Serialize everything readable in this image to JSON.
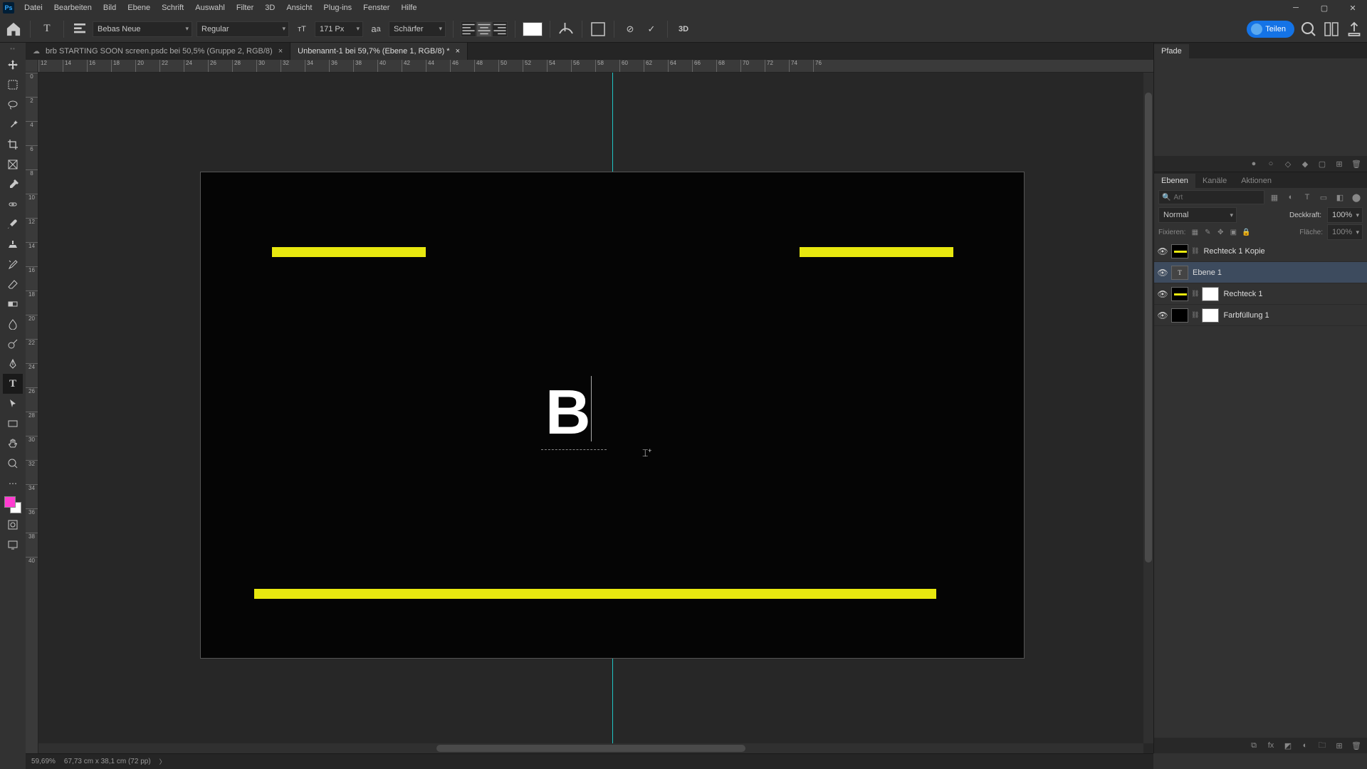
{
  "menu": [
    "Datei",
    "Bearbeiten",
    "Bild",
    "Ebene",
    "Schrift",
    "Auswahl",
    "Filter",
    "3D",
    "Ansicht",
    "Plug-ins",
    "Fenster",
    "Hilfe"
  ],
  "optionsbar": {
    "font_family": "Bebas Neue",
    "font_style": "Regular",
    "font_size": "171 Px",
    "anti_alias": "Schärfer",
    "share_label": "Teilen"
  },
  "tabs": [
    {
      "label": "brb STARTING SOON screen.psdc bei 50,5% (Gruppe 2, RGB/8)",
      "active": false,
      "cloud": true
    },
    {
      "label": "Unbenannt-1 bei 59,7% (Ebene 1, RGB/8) *",
      "active": true,
      "cloud": false
    }
  ],
  "ruler_h": [
    12,
    14,
    16,
    18,
    20,
    22,
    24,
    26,
    28,
    30,
    32,
    34,
    36,
    38,
    40,
    42,
    44,
    46,
    48,
    50,
    52,
    54,
    56,
    58,
    60,
    62,
    64,
    66,
    68,
    70,
    72,
    74,
    76
  ],
  "ruler_v": [
    0,
    2,
    4,
    6,
    8,
    10,
    12,
    14,
    16,
    18,
    20,
    22,
    24,
    26,
    28,
    30,
    32,
    34,
    36,
    38,
    40
  ],
  "canvas_text": "B",
  "panels": {
    "pfade_tab": "Pfade",
    "ebenen_tab": "Ebenen",
    "kanaele_tab": "Kanäle",
    "aktionen_tab": "Aktionen",
    "search_placeholder": "Art",
    "blend_mode": "Normal",
    "opacity_label": "Deckkraft:",
    "opacity_value": "100%",
    "lock_label": "Fixieren:",
    "fill_label": "Fläche:",
    "fill_value": "100%"
  },
  "layers": [
    {
      "name": "Rechteck 1 Kopie",
      "type": "shape",
      "selected": false
    },
    {
      "name": "Ebene 1",
      "type": "text",
      "selected": true
    },
    {
      "name": "Rechteck 1",
      "type": "shape-mask",
      "selected": false
    },
    {
      "name": "Farbfüllung 1",
      "type": "fill",
      "selected": false
    }
  ],
  "status": {
    "zoom": "59,69%",
    "info": "67,73 cm x 38,1 cm (72 pp)"
  }
}
